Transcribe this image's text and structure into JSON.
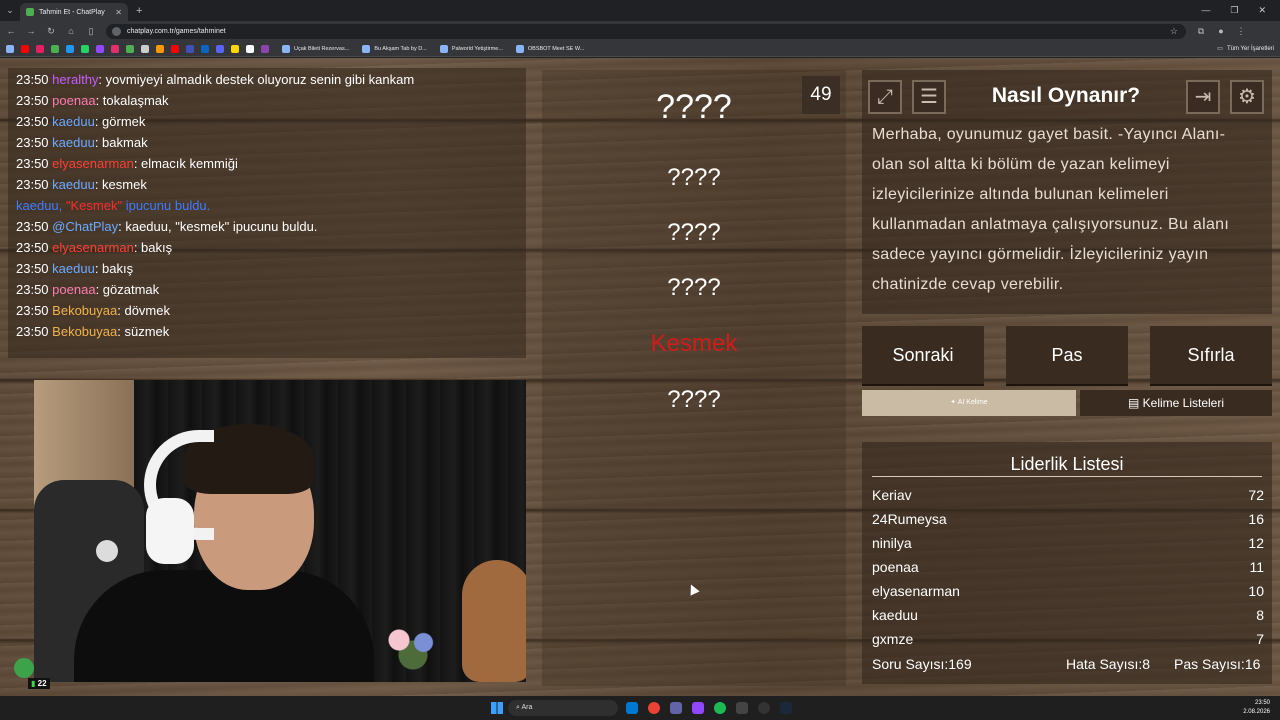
{
  "browser": {
    "tab_title": "Tahmin Et - ChatPlay",
    "url": "chatplay.com.tr/games/tahminet",
    "bookmarks": [
      "Uçak Bileti Rezervas...",
      "Bu Akşam Tab by D...",
      "Palworld Yetiştirme...",
      "OBSBOT Meet SE W..."
    ],
    "all_bookmarks": "Tüm Yer İşaretleri"
  },
  "chat": {
    "messages": [
      {
        "time": "23:50",
        "user": "heralthy",
        "text": ": yovmiyeyi almadık destek oluyoruz senin gibi kankam"
      },
      {
        "time": "23:50",
        "user": "poenaa",
        "text": ": tokalaşmak"
      },
      {
        "time": "23:50",
        "user": "kaeduu",
        "text": ": görmek"
      },
      {
        "time": "23:50",
        "user": "kaeduu",
        "text": ": bakmak"
      },
      {
        "time": "23:50",
        "user": "elyasenarman",
        "text": ": elmacık kemmiği"
      },
      {
        "time": "23:50",
        "user": "kaeduu",
        "text": ": kesmek"
      },
      {
        "time": "",
        "user": "kaeduu,",
        "text": " ipucunu buldu.",
        "highlight": "\"Kesmek\""
      },
      {
        "time": "23:50",
        "user": "@ChatPlay",
        "text": ": kaeduu, \"kesmek\" ipucunu buldu."
      },
      {
        "time": "23:50",
        "user": "elyasenarman",
        "text": ": bakış"
      },
      {
        "time": "23:50",
        "user": "kaeduu",
        "text": ": bakış"
      },
      {
        "time": "23:50",
        "user": "poenaa",
        "text": ": gözatmak"
      },
      {
        "time": "23:50",
        "user": "Bekobuyaa",
        "text": ": dövmek"
      },
      {
        "time": "23:50",
        "user": "Bekobuyaa",
        "text": ": süzmek"
      }
    ]
  },
  "webcam": {
    "viewer_count": "22"
  },
  "game": {
    "timer": "49",
    "main_word": "????",
    "hints": [
      "????",
      "????",
      "????",
      "Kesmek",
      "????"
    ]
  },
  "info": {
    "title": "Nasıl Oynanır?",
    "text": "Merhaba, oyunumuz gayet basit. -Yayıncı Alanı- olan sol altta ki bölüm de yazan kelimeyi izleyicilerinize altında bulunan kelimeleri kullanmadan anlatmaya çalışıyorsunuz. Bu alanı sadece yayıncı görmelidir. İzleyicileriniz yayın chatinizde cevap verebilir."
  },
  "actions": {
    "next": "Sonraki",
    "pass": "Pas",
    "reset": "Sıfırla",
    "ai_word": "AI Kelime",
    "word_lists": "Kelime Listeleri"
  },
  "leaderboard": {
    "title": "Liderlik Listesi",
    "rows": [
      {
        "name": "Keriav",
        "score": "72"
      },
      {
        "name": "24Rumeysa",
        "score": "16"
      },
      {
        "name": "ninilya",
        "score": "12"
      },
      {
        "name": "poenaa",
        "score": "11"
      },
      {
        "name": "elyasenarman",
        "score": "10"
      },
      {
        "name": "kaeduu",
        "score": "8"
      },
      {
        "name": "gxmze",
        "score": "7"
      }
    ],
    "question_count_label": "Soru Sayısı:",
    "question_count": "169",
    "error_count_label": "Hata Sayısı:",
    "error_count": "8",
    "pass_count_label": "Pas Sayısı:",
    "pass_count": "16"
  },
  "taskbar": {
    "search": "Ara",
    "time": "23:50",
    "date": "2.08.2026"
  }
}
